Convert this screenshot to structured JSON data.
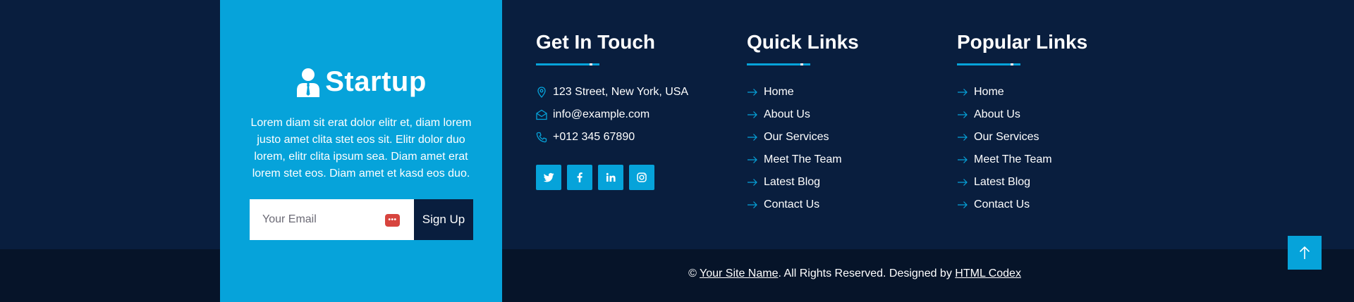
{
  "brand": {
    "name": "Startup",
    "description": "Lorem diam sit erat dolor elitr et, diam lorem justo amet clita stet eos sit. Elitr dolor duo lorem, elitr clita ipsum sea. Diam amet erat lorem stet eos. Diam amet et kasd eos duo."
  },
  "newsletter": {
    "placeholder": "Your Email",
    "button_label": "Sign Up"
  },
  "contact": {
    "title": "Get In Touch",
    "address": "123 Street, New York, USA",
    "email": "info@example.com",
    "phone": "+012 345 67890"
  },
  "socials": [
    "twitter-icon",
    "facebook-icon",
    "linkedin-icon",
    "instagram-icon"
  ],
  "quick_links": {
    "title": "Quick Links",
    "items": [
      "Home",
      "About Us",
      "Our Services",
      "Meet The Team",
      "Latest Blog",
      "Contact Us"
    ]
  },
  "popular_links": {
    "title": "Popular Links",
    "items": [
      "Home",
      "About Us",
      "Our Services",
      "Meet The Team",
      "Latest Blog",
      "Contact Us"
    ]
  },
  "copyright": {
    "prefix": "© ",
    "site_name": "Your Site Name",
    "middle": ". All Rights Reserved. Designed by ",
    "designer": "HTML Codex"
  },
  "colors": {
    "primary": "#06A3DA",
    "dark": "#091E3E",
    "darker": "#061429"
  }
}
